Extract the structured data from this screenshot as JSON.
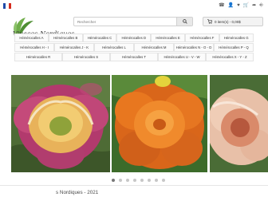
{
  "header": {
    "flag_colors": [
      "#1f4aa8",
      "#ffffff",
      "#d52b1e"
    ],
    "logo_text": "Vivaces Nordiques",
    "search_placeholder": "Rechercher",
    "cart_label": "0 item(s) - 0,00$"
  },
  "nav": {
    "row1": [
      "Hémérocalles A",
      "Hémérocalles B",
      "Hémérocalles C",
      "Hémérocalles D",
      "Hémérocalles E",
      "Hémérocalles F",
      "Hémérocalles G"
    ],
    "row2": [
      "Hémérocalles H - I",
      "Hémérocalles J - K",
      "Hémérocalles L",
      "Hémérocalles M",
      "Hémérocalles N - O - D",
      "Hémérocalles P - Q"
    ],
    "row3": [
      "Hémérocalles R",
      "Hémérocalles S",
      "Hémérocalles T",
      "Hémérocalles U - V - W",
      "Hémérocalles X - Y - Z"
    ]
  },
  "slider": {
    "dot_count": 8,
    "active_dot": 1
  },
  "footer": {
    "text": "s Nordiques - 2021"
  }
}
